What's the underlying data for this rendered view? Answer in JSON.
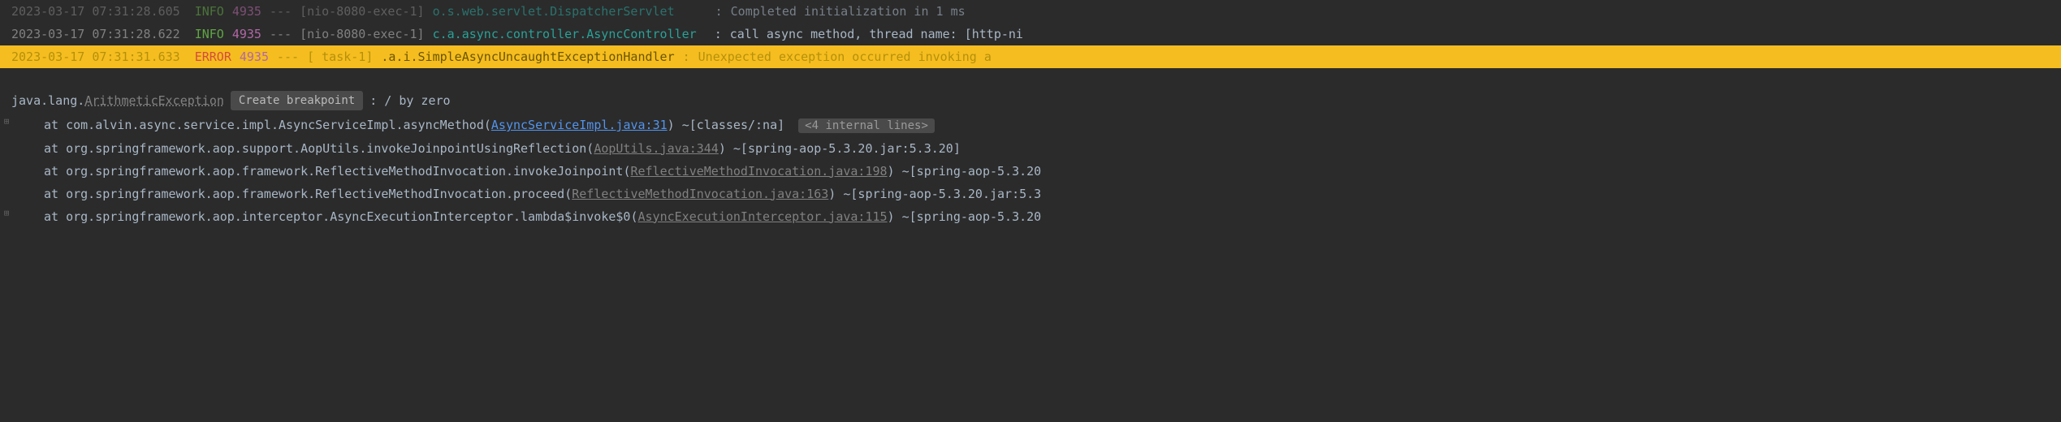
{
  "log_lines": [
    {
      "timestamp": "2023-03-17 07:31:28.605",
      "level": "INFO",
      "pid": "4935",
      "dashes": "---",
      "thread": "[nio-8080-exec-1]",
      "logger": "o.s.web.servlet.DispatcherServlet",
      "colon": ":",
      "message": "Completed initialization in 1 ms"
    },
    {
      "timestamp": "2023-03-17 07:31:28.622",
      "level": "INFO",
      "pid": "4935",
      "dashes": "---",
      "thread": "[nio-8080-exec-1]",
      "logger": "c.a.async.controller.AsyncController",
      "colon": ":",
      "message": "call async method, thread name: [http-ni"
    },
    {
      "timestamp": "2023-03-17 07:31:31.633",
      "level": "ERROR",
      "pid": "4935",
      "dashes": "---",
      "thread": "[         task-1]",
      "logger": ".a.i.SimpleAsyncUncaughtExceptionHandler",
      "colon": ":",
      "message": "Unexpected exception occurred invoking a"
    }
  ],
  "exception": {
    "prefix": "java.lang.",
    "name": "ArithmeticException",
    "breakpoint_label": "Create breakpoint",
    "message": ": / by zero"
  },
  "stack": [
    {
      "at": "at ",
      "method": "com.alvin.async.service.impl.AsyncServiceImpl.asyncMethod",
      "paren_open": "(",
      "link": "AsyncServiceImpl.java:31",
      "paren_close": ")",
      "jar": " ~[classes/:na]",
      "internal": "<4 internal lines>",
      "gutter": true,
      "link_bright": true
    },
    {
      "at": "at ",
      "method": "org.springframework.aop.support.AopUtils.invokeJoinpointUsingReflection",
      "paren_open": "(",
      "link": "AopUtils.java:344",
      "paren_close": ")",
      "jar": " ~[spring-aop-5.3.20.jar:5.3.20]",
      "gutter": false,
      "link_bright": false
    },
    {
      "at": "at ",
      "method": "org.springframework.aop.framework.ReflectiveMethodInvocation.invokeJoinpoint",
      "paren_open": "(",
      "link": "ReflectiveMethodInvocation.java:198",
      "paren_close": ")",
      "jar": " ~[spring-aop-5.3.20",
      "gutter": false,
      "link_bright": false
    },
    {
      "at": "at ",
      "method": "org.springframework.aop.framework.ReflectiveMethodInvocation.proceed",
      "paren_open": "(",
      "link": "ReflectiveMethodInvocation.java:163",
      "paren_close": ")",
      "jar": " ~[spring-aop-5.3.20.jar:5.3",
      "gutter": false,
      "link_bright": false
    },
    {
      "at": "at ",
      "method": "org.springframework.aop.interceptor.AsyncExecutionInterceptor.lambda$invoke$0",
      "paren_open": "(",
      "link": "AsyncExecutionInterceptor.java:115",
      "paren_close": ")",
      "jar": " ~[spring-aop-5.3.20",
      "gutter": true,
      "link_bright": false
    }
  ]
}
